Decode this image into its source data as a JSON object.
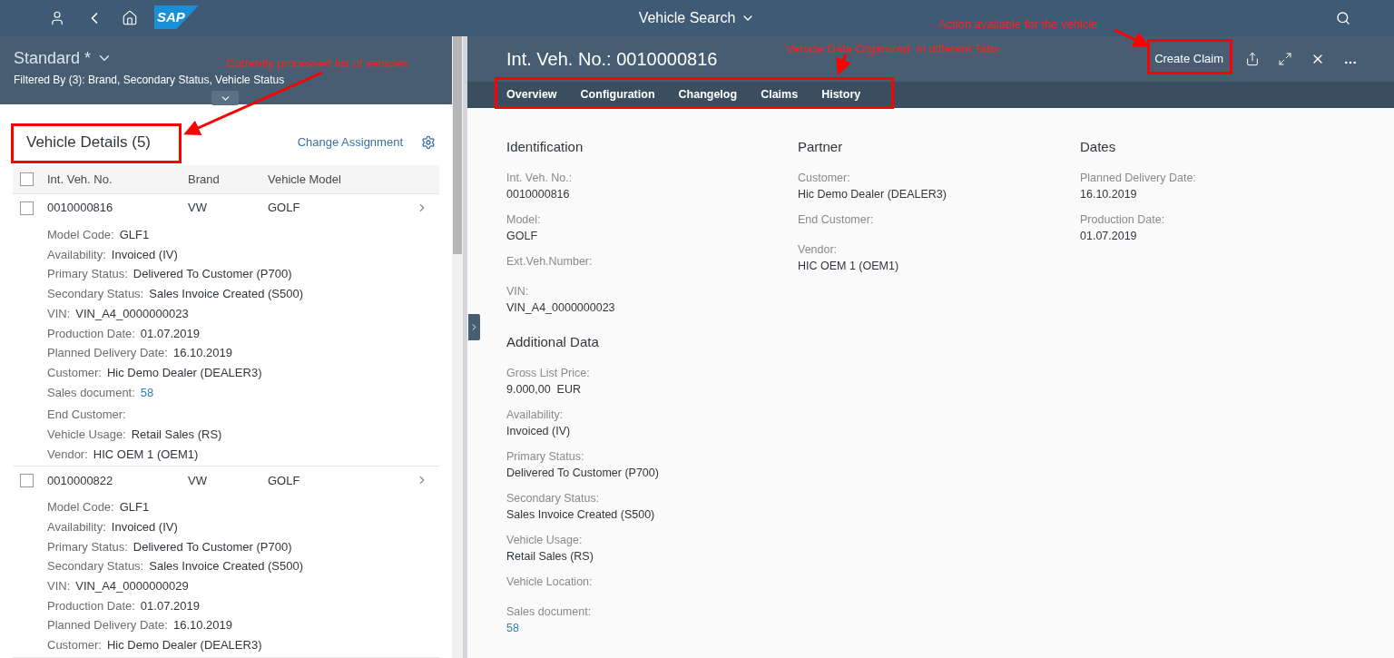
{
  "shell": {
    "logo": "SAP",
    "title": "Vehicle Search"
  },
  "variant": {
    "name": "Standard *",
    "filter": "Filtered By (3): Brand, Secondary Status, Vehicle Status"
  },
  "list": {
    "title": "Vehicle Details (5)",
    "action": "Change Assignment",
    "all_checked": false,
    "columns": [
      "Int. Veh. No.",
      "Brand",
      "Vehicle Model"
    ],
    "rows": [
      {
        "checked": false,
        "number": "0010000816",
        "brand": "VW",
        "model": "GOLF",
        "details": [
          {
            "label": "Model Code:",
            "value": "GLF1"
          },
          {
            "label": "Availability:",
            "value": "Invoiced (IV)"
          },
          {
            "label": "Primary Status:",
            "value": "Delivered To Customer (P700)"
          },
          {
            "label": "Secondary Status:",
            "value": "Sales Invoice Created (S500)"
          },
          {
            "label": "VIN:",
            "value": "VIN_A4_0000000023"
          },
          {
            "label": "Production Date:",
            "value": "01.07.2019"
          },
          {
            "label": "Planned Delivery Date:",
            "value": "16.10.2019"
          },
          {
            "label": "Customer:",
            "value": "Hic Demo Dealer (DEALER3)"
          },
          {
            "label": "Sales document:",
            "value": "58",
            "link": true
          },
          {
            "label": "End Customer:"
          },
          {
            "label": "Vehicle Usage:",
            "value": "Retail Sales (RS)"
          },
          {
            "label": "Vendor:",
            "value": "HIC OEM 1 (OEM1)"
          }
        ]
      },
      {
        "checked": false,
        "number": "0010000822",
        "brand": "VW",
        "model": "GOLF",
        "details": [
          {
            "label": "Model Code:",
            "value": "GLF1"
          },
          {
            "label": "Availability:",
            "value": "Invoiced (IV)"
          },
          {
            "label": "Primary Status:",
            "value": "Delivered To Customer (P700)"
          },
          {
            "label": "Secondary Status:",
            "value": "Sales Invoice Created (S500)"
          },
          {
            "label": "VIN:",
            "value": "VIN_A4_0000000029"
          },
          {
            "label": "Production Date:",
            "value": "01.07.2019"
          },
          {
            "label": "Planned Delivery Date:",
            "value": "16.10.2019"
          },
          {
            "label": "Customer:",
            "value": "Hic Demo Dealer (DEALER3)"
          }
        ]
      }
    ]
  },
  "detail": {
    "title": "Int. Veh. No.: 0010000816",
    "action": "Create Claim",
    "tabs": [
      "Overview",
      "Configuration",
      "Changelog",
      "Claims",
      "History"
    ],
    "sections": [
      {
        "title": "Identification",
        "fields": [
          {
            "label": "Int. Veh. No.:",
            "value": "0010000816"
          },
          {
            "label": "Model:",
            "value": "GOLF"
          },
          {
            "label": "Ext.Veh.Number:"
          },
          {
            "label": "VIN:",
            "value": "VIN_A4_0000000023"
          }
        ]
      },
      {
        "title": "Partner",
        "fields": [
          {
            "label": "Customer:",
            "value": "Hic Demo Dealer (DEALER3)"
          },
          {
            "label": "End Customer:"
          },
          {
            "label": "Vendor:",
            "value": "HIC OEM 1 (OEM1)"
          }
        ]
      },
      {
        "title": "Dates",
        "fields": [
          {
            "label": "Planned Delivery Date:",
            "value": "16.10.2019"
          },
          {
            "label": "Production Date:",
            "value": "01.07.2019"
          }
        ]
      },
      {
        "title": "Additional Data",
        "fields": [
          {
            "label": "Gross List Price:",
            "value": "9.000,00  EUR"
          },
          {
            "label": "Availability:",
            "value": "Invoiced (IV)"
          },
          {
            "label": "Primary Status:",
            "value": "Delivered To Customer (P700)"
          },
          {
            "label": "Secondary Status:",
            "value": "Sales Invoice Created (S500)"
          },
          {
            "label": "Vehicle Usage:",
            "value": "Retail Sales (RS)"
          },
          {
            "label": "Vehicle Location:"
          },
          {
            "label": "Sales document:",
            "value": "58",
            "link": true
          }
        ]
      }
    ]
  },
  "annotations": [
    {
      "text": "Currently processed list of vehicles"
    },
    {
      "text": "Vehicle Data Organized  in different Tabs"
    },
    {
      "text": "Action available for the vehicle"
    }
  ]
}
